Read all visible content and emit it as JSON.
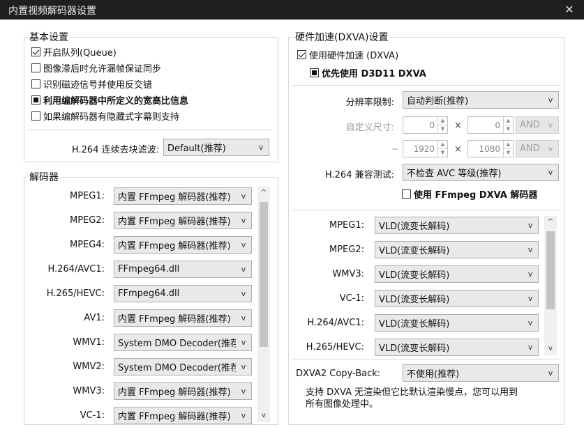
{
  "window": {
    "title": "内置视频解码器设置",
    "close_glyph": "✕"
  },
  "basic": {
    "legend": "基本设置",
    "options": [
      {
        "label": "开启队列(Queue)",
        "state": "checked"
      },
      {
        "label": "图像滞后时允许漏帧保证同步",
        "state": "unchecked"
      },
      {
        "label": "识别磁迹信号并使用反交错",
        "state": "unchecked"
      },
      {
        "label": "利用编解码器中所定义的宽高比信息",
        "state": "indeterminate"
      },
      {
        "label": "如果编解码器有隐藏式字幕则支持",
        "state": "unchecked"
      }
    ],
    "deblock_label": "H.264 连续去块滤波:",
    "deblock_value": "Default(推荐)"
  },
  "decoders": {
    "legend": "解码器",
    "items": [
      {
        "label": "MPEG1:",
        "value": "内置 FFmpeg 解码器(推荐)"
      },
      {
        "label": "MPEG2:",
        "value": "内置 FFmpeg 解码器(推荐)"
      },
      {
        "label": "MPEG4:",
        "value": "内置 FFmpeg 解码器(推荐)"
      },
      {
        "label": "H.264/AVC1:",
        "value": "FFmpeg64.dll"
      },
      {
        "label": "H.265/HEVC:",
        "value": "FFmpeg64.dll"
      },
      {
        "label": "AV1:",
        "value": "内置 FFmpeg 解码器(推荐)"
      },
      {
        "label": "WMV1:",
        "value": "System DMO Decoder(推荐)"
      },
      {
        "label": "WMV2:",
        "value": "System DMO Decoder(推荐)"
      },
      {
        "label": "WMV3:",
        "value": "内置 FFmpeg 解码器(推荐)"
      },
      {
        "label": "VC-1:",
        "value": "内置 FFmpeg 解码器(推荐)"
      }
    ]
  },
  "hw": {
    "legend": "硬件加速(DXVA)设置",
    "use_hw_label": "使用硬件加速 (DXVA)",
    "d3d11_label": "优先使用 D3D11 DXVA",
    "resolution_label": "分辨率限制:",
    "resolution_value": "自动判断(推荐)",
    "custom_size_label": "自定义尺寸:",
    "min_w": "0",
    "min_h": "0",
    "max_w": "1920",
    "max_h": "1080",
    "and_label": "AND",
    "times_glyph": "×",
    "tilde_glyph": "~",
    "compat_label": "H.264 兼容测试:",
    "compat_value": "不检查 AVC 等级(推荐)",
    "ffmpeg_dxva_label": "使用 FFmpeg DXVA 解码器",
    "modes": [
      {
        "label": "MPEG1:",
        "value": "VLD(流变长解码)"
      },
      {
        "label": "MPEG2:",
        "value": "VLD(流变长解码)"
      },
      {
        "label": "WMV3:",
        "value": "VLD(流变长解码)"
      },
      {
        "label": "VC-1:",
        "value": "VLD(流变长解码)"
      },
      {
        "label": "H.264/AVC1:",
        "value": "VLD(流变长解码)"
      },
      {
        "label": "H.265/HEVC:",
        "value": "VLD(流变长解码)"
      }
    ],
    "copyback_label": "DXVA2 Copy-Back:",
    "copyback_value": "不使用(推荐)",
    "info_text_line1": "支持 DXVA 无渲染但它比默认渲染慢点，您可以用到",
    "info_text_line2": "所有图像处理中。"
  },
  "glyphs": {
    "dropdown": "v",
    "scroll_up": "^",
    "scroll_down": "v",
    "spin_up": "▲",
    "spin_down": "▼"
  }
}
